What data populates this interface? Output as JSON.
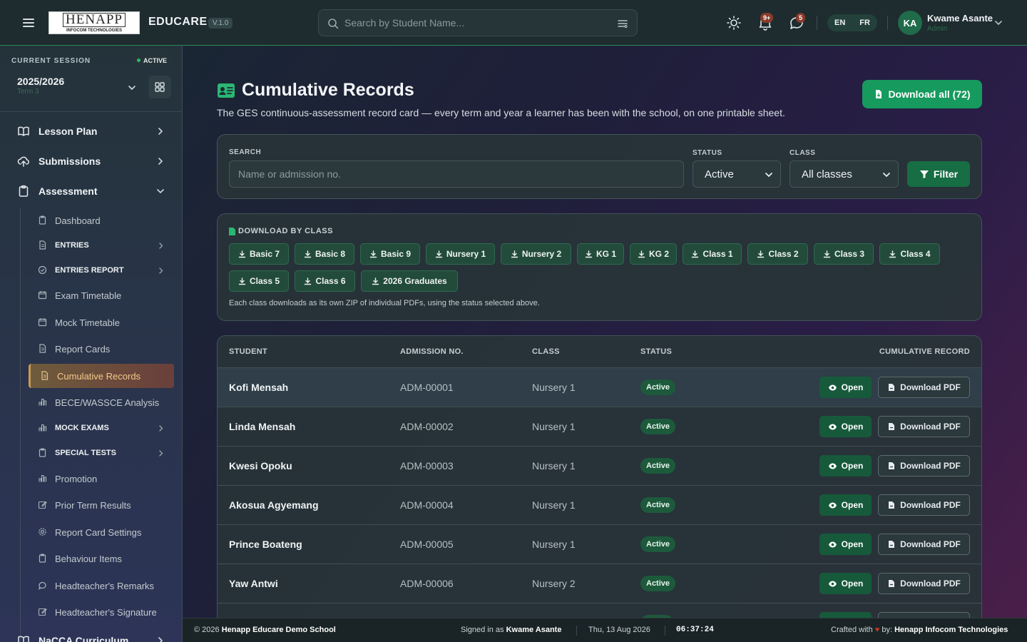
{
  "header": {
    "logo_main": "HENAPP",
    "logo_sub": "INFOCOM TECHNOLOGIES",
    "brand": "EDUCARE",
    "version": "V.1.0",
    "search_placeholder": "Search by Student Name...",
    "notifications_badge": "9+",
    "messages_badge": "5",
    "lang_en": "EN",
    "lang_fr": "FR",
    "user_initials": "KA",
    "user_name": "Kwame Asante",
    "user_role": "Admin"
  },
  "sidebar": {
    "session_label": "CURRENT SESSION",
    "session_status": "ACTIVE",
    "session_year": "2025/2026",
    "session_term": "Term 3",
    "nav": [
      {
        "label": "Lesson Plan",
        "icon": "book-open-icon"
      },
      {
        "label": "Submissions",
        "icon": "cloud-upload-icon"
      },
      {
        "label": "Assessment",
        "icon": "clipboard-icon"
      }
    ],
    "assessment_items": [
      {
        "label": "Dashboard",
        "icon": "clipboard-icon",
        "bold": false
      },
      {
        "label": "ENTRIES",
        "icon": "file-icon",
        "bold": true
      },
      {
        "label": "ENTRIES REPORT",
        "icon": "check-circle-icon",
        "bold": true
      },
      {
        "label": "Exam Timetable",
        "icon": "calendar-icon",
        "bold": false
      },
      {
        "label": "Mock Timetable",
        "icon": "calendar-icon",
        "bold": false
      },
      {
        "label": "Report Cards",
        "icon": "file-icon",
        "bold": false
      },
      {
        "label": "Cumulative Records",
        "icon": "file-icon",
        "bold": false
      },
      {
        "label": "BECE/WASSCE Analysis",
        "icon": "bar-chart-icon",
        "bold": false
      },
      {
        "label": "MOCK EXAMS",
        "icon": "bar-chart-icon",
        "bold": true
      },
      {
        "label": "SPECIAL TESTS",
        "icon": "clipboard-icon",
        "bold": true
      },
      {
        "label": "Promotion",
        "icon": "bar-chart-icon",
        "bold": false
      },
      {
        "label": "Prior Term Results",
        "icon": "edit-icon",
        "bold": false
      },
      {
        "label": "Report Card Settings",
        "icon": "gear-icon",
        "bold": false
      },
      {
        "label": "Behaviour Items",
        "icon": "clipboard-icon",
        "bold": false
      },
      {
        "label": "Headteacher's Remarks",
        "icon": "chat-icon",
        "bold": false
      },
      {
        "label": "Headteacher's Signature",
        "icon": "edit-icon",
        "bold": false
      }
    ],
    "nacca_label": "NaCCA Curriculum"
  },
  "main": {
    "title": "Cumulative Records",
    "subtitle": "The GES continuous-assessment record card — every term and year a learner has been with the school, on one printable sheet.",
    "download_all": "Download all (72)",
    "filter": {
      "search_label": "SEARCH",
      "search_placeholder": "Name or admission no.",
      "status_label": "STATUS",
      "status_value": "Active",
      "class_label": "CLASS",
      "class_value": "All classes",
      "filter_button": "Filter"
    },
    "download_by_class": {
      "title": "DOWNLOAD BY CLASS",
      "classes": [
        "Basic 7",
        "Basic 8",
        "Basic 9",
        "Nursery 1",
        "Nursery 2",
        "KG 1",
        "KG 2",
        "Class 1",
        "Class 2",
        "Class 3",
        "Class 4",
        "Class 5",
        "Class 6",
        "2026 Graduates"
      ],
      "note": "Each class downloads as its own ZIP of individual PDFs, using the status selected above."
    },
    "table": {
      "headers": [
        "STUDENT",
        "ADMISSION NO.",
        "CLASS",
        "STATUS",
        "CUMULATIVE RECORD"
      ],
      "open_label": "Open",
      "pdf_label": "Download PDF",
      "rows": [
        {
          "name": "Kofi Mensah",
          "adm": "ADM-00001",
          "class": "Nursery 1",
          "status": "Active"
        },
        {
          "name": "Linda Mensah",
          "adm": "ADM-00002",
          "class": "Nursery 1",
          "status": "Active"
        },
        {
          "name": "Kwesi Opoku",
          "adm": "ADM-00003",
          "class": "Nursery 1",
          "status": "Active"
        },
        {
          "name": "Akosua Agyemang",
          "adm": "ADM-00004",
          "class": "Nursery 1",
          "status": "Active"
        },
        {
          "name": "Prince Boateng",
          "adm": "ADM-00005",
          "class": "Nursery 1",
          "status": "Active"
        },
        {
          "name": "Yaw Antwi",
          "adm": "ADM-00006",
          "class": "Nursery 2",
          "status": "Active"
        }
      ]
    }
  },
  "footer": {
    "copyright_prefix": "© 2026",
    "school": "Henapp Educare Demo School",
    "signed_prefix": "Signed in as",
    "signed_user": "Kwame Asante",
    "date": "Thu, 13 Aug 2026",
    "time": "06:37:24",
    "crafted_prefix": "Crafted with",
    "crafted_by": "by:",
    "company": "Henapp Infocom Technologies"
  },
  "colors": {
    "accent_green": "#169a5d",
    "active_nav": "#6e5b3c",
    "header_bg": "#1e2c2f"
  }
}
